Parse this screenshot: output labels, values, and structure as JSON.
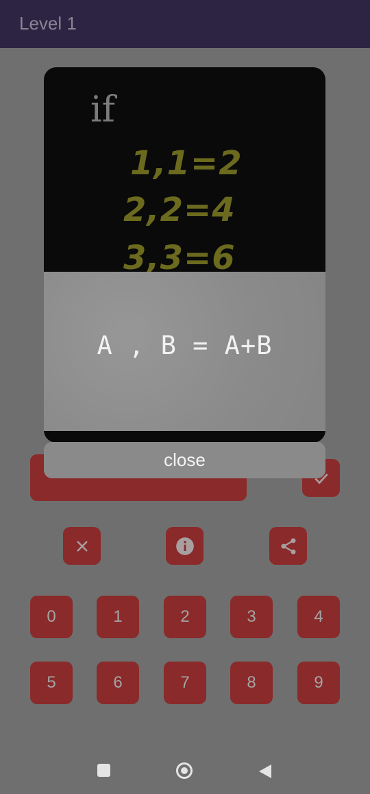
{
  "appbar": {
    "title": "Level 1"
  },
  "hint_dialog": {
    "image_text": {
      "if": "if",
      "lines": [
        "1,1=2",
        "2,2=4",
        "3,3=6"
      ]
    },
    "formula": "A , B = A+B",
    "close_label": "close"
  },
  "keypad": {
    "row1": [
      "0",
      "1",
      "2",
      "3",
      "4"
    ],
    "row2": [
      "5",
      "6",
      "7",
      "8",
      "9"
    ]
  },
  "colors": {
    "appbar": "#2c2442",
    "button_red": "#8a2a2a",
    "scrim_gray": "#6f6f6f"
  },
  "icons": {
    "check": "check-icon",
    "clear": "close-icon",
    "info": "info-icon",
    "share": "share-icon",
    "nav_recents": "square-icon",
    "nav_home": "circle-icon",
    "nav_back": "triangle-back-icon"
  }
}
